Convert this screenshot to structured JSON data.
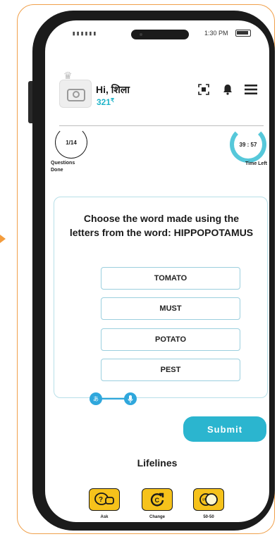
{
  "status_bar": {
    "signal": "▮▮▮▮▮▮",
    "time": "1:30 PM"
  },
  "user": {
    "greeting": "Hi, शिला",
    "points": "321"
  },
  "progress": {
    "questions_done_value": "1/14",
    "questions_done_label": "Questions Done",
    "timer_value": "39 : 57",
    "timer_label": "Time Left"
  },
  "question": {
    "text": "Choose the word made using the letters from the word: HIPPOPOTAMUS"
  },
  "options": [
    "TOMATO",
    "MUST",
    "POTATO",
    "PEST"
  ],
  "submit_label": "Submit",
  "lifelines": {
    "title": "Lifelines",
    "items": [
      {
        "label": "Ask",
        "icon": "ask-bubble-icon"
      },
      {
        "label": "Change",
        "icon": "change-icon"
      },
      {
        "label": "50-50",
        "icon": "fifty-fifty-icon"
      }
    ]
  },
  "colors": {
    "accent": "#2bb5cf",
    "lifeline_yellow": "#f6c21b",
    "frame_orange": "#f0a04b"
  }
}
